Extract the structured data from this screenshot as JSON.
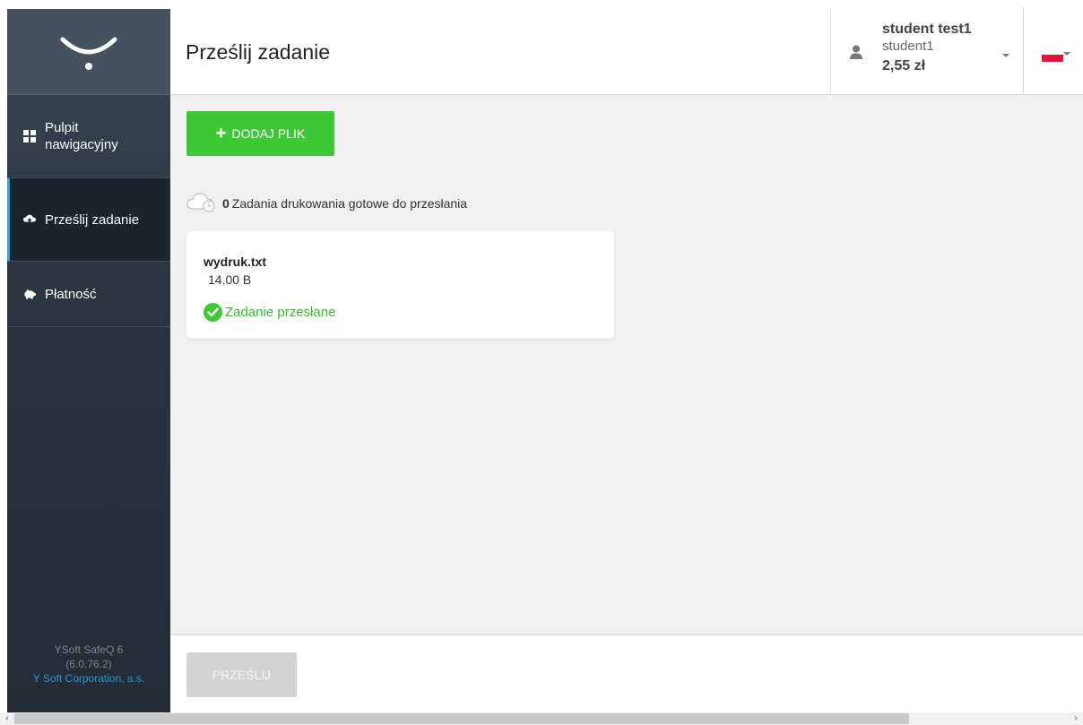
{
  "sidebar": {
    "items": [
      {
        "label": "Pulpit nawigacyjny",
        "icon": "dashboard-grid-icon",
        "active": false
      },
      {
        "label": "Prześlij zadanie",
        "icon": "cloud-upload-icon",
        "active": true
      },
      {
        "label": "Płatność",
        "icon": "piggy-bank-icon",
        "active": false
      }
    ],
    "footer": {
      "product": "YSoft SafeQ 6",
      "version": "(6.0.76.2)",
      "company": "Y Soft Corporation, a.s."
    }
  },
  "header": {
    "title": "Prześlij zadanie",
    "user": {
      "name": "student test1",
      "login": "student1",
      "credit": "2,55 zł"
    },
    "language": {
      "flag": "PL",
      "colors": [
        "#ffffff",
        "#e3173d"
      ]
    }
  },
  "main": {
    "add_button_label": "DODAJ PLIK",
    "queue": {
      "count": "0",
      "text": "Zadania drukowania gotowe do przesłania"
    },
    "files": [
      {
        "name": "wydruk.txt",
        "size": "14.00 B",
        "status": "Zadanie przesłane"
      }
    ]
  },
  "footer": {
    "submit_label": "PRZEŚLIJ",
    "submit_enabled": false
  },
  "colors": {
    "accent_green": "#3ec837",
    "sidebar_bg": "#2b3641",
    "active_indicator": "#2aa8d8",
    "link_blue": "#2f93d6"
  }
}
